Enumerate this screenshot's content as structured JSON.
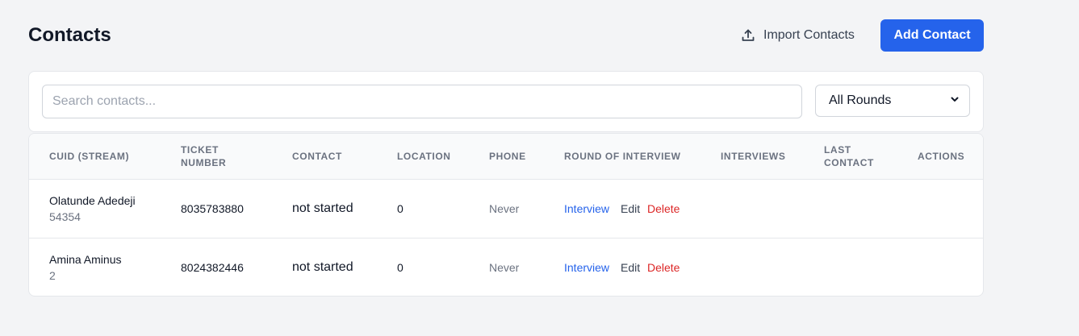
{
  "header": {
    "title": "Contacts",
    "import_label": "Import Contacts",
    "add_label": "Add Contact"
  },
  "filters": {
    "search_placeholder": "Search contacts...",
    "round_selected": "All Rounds"
  },
  "table": {
    "columns": [
      "CUID (STREAM)",
      "TICKET NUMBER",
      "CONTACT",
      "LOCATION",
      "PHONE",
      "ROUND OF INTERVIEW",
      "INTERVIEWS",
      "LAST CONTACT",
      "ACTIONS"
    ],
    "column_lines": {
      "ticket_1": "TICKET",
      "ticket_2": "NUMBER",
      "last_1": "LAST",
      "last_2": "CONTACT"
    },
    "rows": [
      {
        "name": "Olatunde Adedeji",
        "stream": "54354",
        "ticket": "8035783880",
        "contact": "not started",
        "location": "0",
        "phone": "Never",
        "actions": {
          "interview": "Interview",
          "edit": "Edit",
          "delete": "Delete"
        }
      },
      {
        "name": "Amina Aminus",
        "stream": "2",
        "ticket": "8024382446",
        "contact": "not started",
        "location": "0",
        "phone": "Never",
        "actions": {
          "interview": "Interview",
          "edit": "Edit",
          "delete": "Delete"
        }
      }
    ]
  },
  "icons": {
    "import": "upload-icon",
    "select": "chevron-down-icon"
  },
  "colors": {
    "primary": "#2563eb",
    "danger": "#dc2626",
    "background": "#f3f4f6"
  }
}
